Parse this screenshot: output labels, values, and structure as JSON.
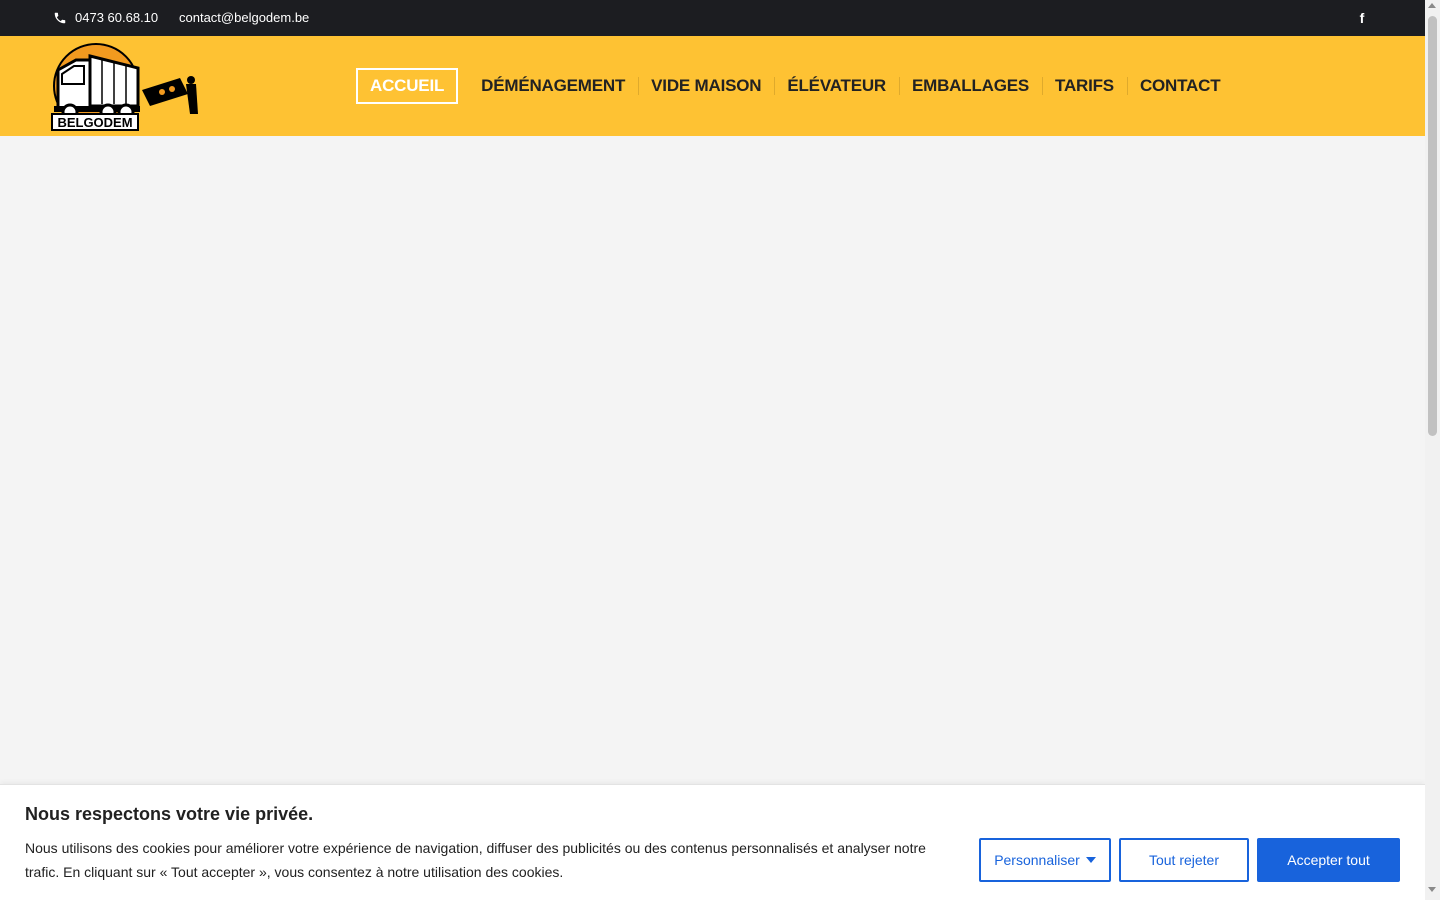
{
  "topbar": {
    "phone": "0473 60.68.10",
    "email": "contact@belgodem.be",
    "social_icon": "facebook-icon"
  },
  "logo": {
    "brand_text": "BELGODEM",
    "colors": {
      "sun": "#f29a1f",
      "truck": "#ffffff",
      "outline": "#000000"
    }
  },
  "nav": {
    "items": [
      {
        "label": "ACCUEIL",
        "active": true
      },
      {
        "label": "DÉMÉNAGEMENT"
      },
      {
        "label": "VIDE MAISON"
      },
      {
        "label": "ÉLÉVATEUR"
      },
      {
        "label": "EMBALLAGES"
      },
      {
        "label": "TARIFS"
      },
      {
        "label": "CONTACT"
      }
    ]
  },
  "cookie": {
    "title": "Nous respectons votre vie privée.",
    "text": "Nous utilisons des cookies pour améliorer votre expérience de navigation, diffuser des publicités ou des contenus personnalisés et analyser notre trafic. En cliquant sur « Tout accepter », vous consentez à notre utilisation des cookies.",
    "customize_label": "Personnaliser",
    "reject_label": "Tout rejeter",
    "accept_label": "Accepter tout"
  },
  "colors": {
    "topbar_bg": "#1c1d21",
    "header_bg": "#fec233",
    "page_bg": "#f4f4f4",
    "accent_blue": "#1863dc"
  }
}
